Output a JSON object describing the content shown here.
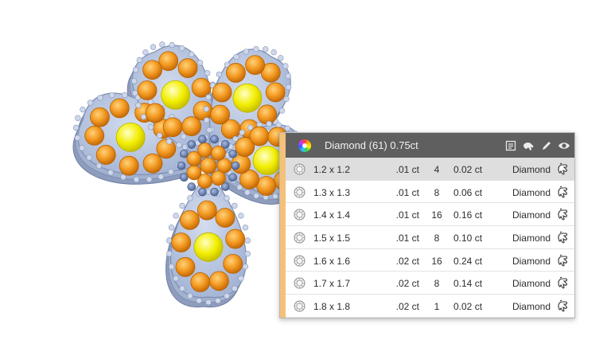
{
  "viewport": {
    "model": "flower-pendant-3d"
  },
  "panel": {
    "title": "Diamond (61) 0.75ct",
    "icons": [
      "list-icon",
      "paint-hand-icon",
      "pencil-icon",
      "eye-icon"
    ],
    "accent_color": "#f4c07a",
    "rows": [
      {
        "size": "1.2 x 1.2",
        "carat": ".01 ct",
        "qty": "4",
        "total": "0.02 ct",
        "material": "Diamond",
        "selected": true
      },
      {
        "size": "1.3 x 1.3",
        "carat": ".01 ct",
        "qty": "8",
        "total": "0.06 ct",
        "material": "Diamond"
      },
      {
        "size": "1.4 x 1.4",
        "carat": ".01 ct",
        "qty": "16",
        "total": "0.16 ct",
        "material": "Diamond"
      },
      {
        "size": "1.5 x 1.5",
        "carat": ".01 ct",
        "qty": "8",
        "total": "0.10 ct",
        "material": "Diamond"
      },
      {
        "size": "1.6 x 1.6",
        "carat": ".02 ct",
        "qty": "16",
        "total": "0.24 ct",
        "material": "Diamond"
      },
      {
        "size": "1.7 x 1.7",
        "carat": ".02 ct",
        "qty": "8",
        "total": "0.14 ct",
        "material": "Diamond"
      },
      {
        "size": "1.8 x 1.8",
        "carat": ".02 ct",
        "qty": "1",
        "total": "0.02 ct",
        "material": "Diamond"
      }
    ]
  },
  "colors": {
    "metal": "#b3c0da",
    "metal_dark": "#8a99b8",
    "stone_orange": "#f29a22",
    "stone_yellow": "#f3f000",
    "center_blue": "#6f86b8"
  }
}
